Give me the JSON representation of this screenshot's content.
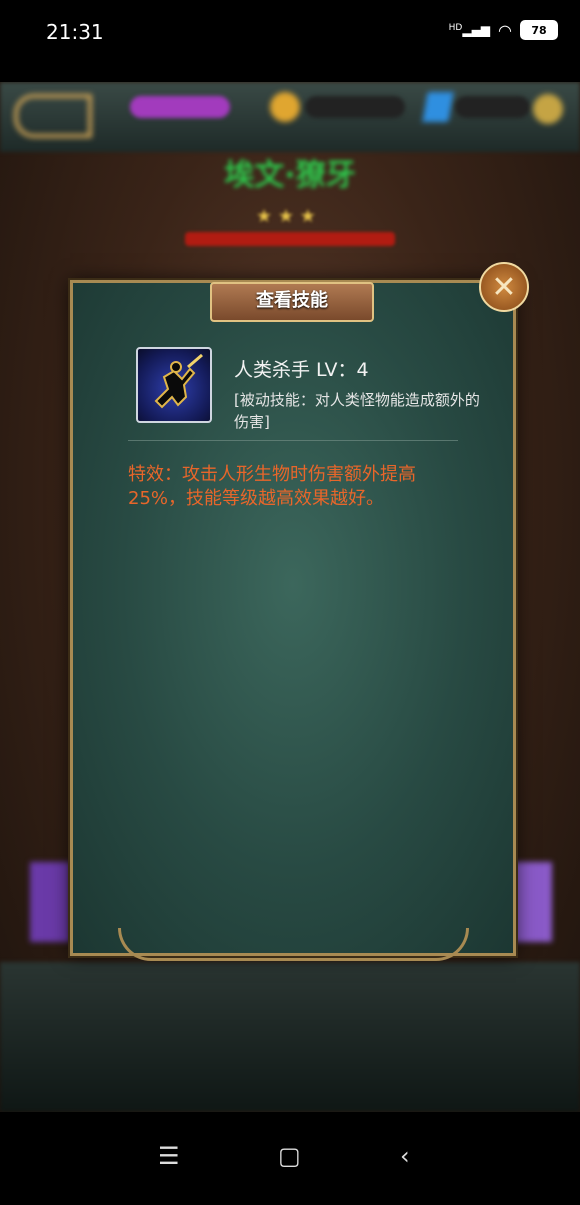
{
  "status_bar": {
    "time": "21:31",
    "network": "HD",
    "battery": "78"
  },
  "background": {
    "hero_name": "埃文·獠牙"
  },
  "dialog": {
    "title": "查看技能",
    "skill": {
      "name_line": "人类杀手  LV：4",
      "description": "[被动技能：对人类怪物能造成额外的伤害]"
    },
    "effect_text": "特效：攻击人形生物时伤害额外提高25%，技能等级越高效果越好。"
  },
  "colors": {
    "effect_text": "#e8662a",
    "panel": "#2c5048",
    "frame_gold": "#a88a52"
  },
  "icons": {
    "close": "close-icon",
    "skill": "jumping-warrior-icon",
    "nav_menu": "menu-icon",
    "nav_home": "home-square-icon",
    "nav_back": "back-chevron-icon"
  }
}
